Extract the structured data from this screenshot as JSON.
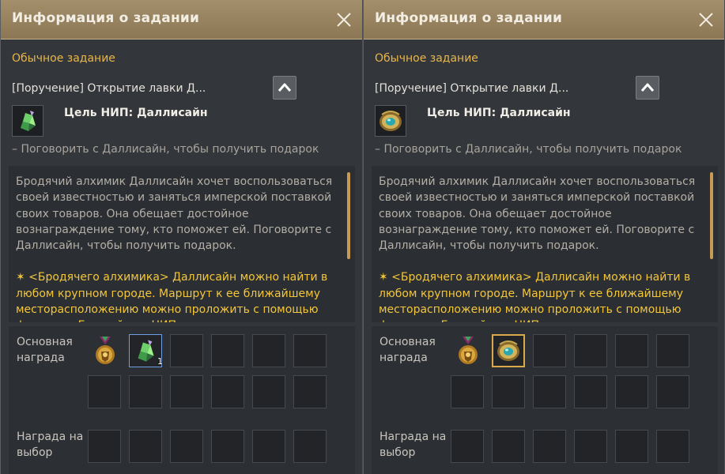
{
  "panels": [
    {
      "title": "Информация о задании",
      "quest_type": "Обычное задание",
      "quest_name": "[Поручение] Открытие лавки Д...",
      "target": "Цель НИП: Даллисайн",
      "subtask": "– Поговорить с Даллисайн, чтобы получить подарок",
      "description": "Бродячий алхимик Даллисайн хочет воспользоваться своей известностью и заняться имперской поставкой своих товаров. Она обещает достойное вознаграждение тому, кто поможет ей. Поговорите с Даллисайн, чтобы получить подарок.",
      "hint": "✶ <Бродячего алхимика> Даллисайн можно найти в любом крупном городе. Маршрут к ее ближайшему месторасположению можно проложить с помощью функции «Ближайшие НИП».",
      "main_reward_label": "Основная награда",
      "choice_reward_label": "Награда на выбор",
      "reward_item_count": "1",
      "quest_icon": "green-crystal-icon",
      "reward_icons": [
        "medal-icon",
        "green-crystal-icon"
      ]
    },
    {
      "title": "Информация о задании",
      "quest_type": "Обычное задание",
      "quest_name": "[Поручение] Открытие лавки Д...",
      "target": "Цель НИП: Даллисайн",
      "subtask": "– Поговорить с Даллисайн, чтобы получить подарок",
      "description": "Бродячий алхимик Даллисайн хочет воспользоваться своей известностью и заняться имперской поставкой своих товаров. Она обещает достойное вознаграждение тому, кто поможет ей. Поговорите с Даллисайн, чтобы получить подарок.",
      "hint": "✶ <Бродячего алхимика> Даллисайн можно найти в любом крупном городе. Маршрут к ее ближайшему месторасположению можно проложить с помощью функции «Ближайшие НИП».",
      "main_reward_label": "Основная награда",
      "choice_reward_label": "Награда на выбор",
      "quest_icon": "gold-amulet-icon",
      "reward_icons": [
        "medal-icon",
        "gold-amulet-icon"
      ]
    }
  ],
  "colors": {
    "title_bar": "#9a8562",
    "quest_type": "#e8b64a",
    "hint_text": "#f3c63a",
    "description_text": "#b4afa6",
    "selected_slot_blue": "#6f9fe0",
    "selected_slot_gold": "#d9a94a"
  }
}
